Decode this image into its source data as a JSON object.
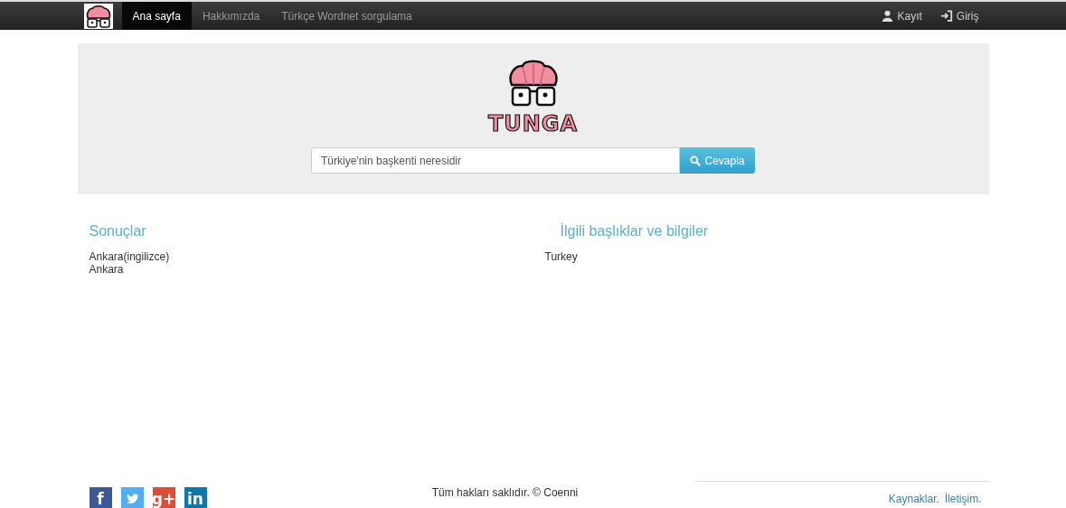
{
  "navbar": {
    "items": [
      {
        "label": "Ana sayfa",
        "selected": true
      },
      {
        "label": "Hakkımızda",
        "selected": false
      },
      {
        "label": "Türkçe Wordnet sorgulama",
        "selected": false
      }
    ],
    "right_items": [
      {
        "kind": "user",
        "label": "Kayıt"
      },
      {
        "kind": "login",
        "label": "Giriş"
      }
    ]
  },
  "hero": {
    "logo_text": "TUNGA",
    "search": {
      "value": "Türkiye'nin başkenti neresidir"
    },
    "button": "Cevapla"
  },
  "results": {
    "title": "Sonuçlar",
    "items": [
      "Ankara(ingilizce)",
      "Ankara"
    ]
  },
  "related": {
    "title": "İlgili başlıklar ve bilgiler",
    "items": [
      "Turkey"
    ]
  },
  "footer": {
    "social": [
      {
        "kind": "facebook",
        "glyph": "f"
      },
      {
        "kind": "twitter"
      },
      {
        "kind": "googleplus",
        "glyph": "g+"
      },
      {
        "kind": "linkedin",
        "glyph": "in"
      }
    ],
    "copyright": "Tüm hakları saklıdır. © Coenni",
    "links": [
      "Kaynaklar.",
      "İletişim."
    ]
  }
}
